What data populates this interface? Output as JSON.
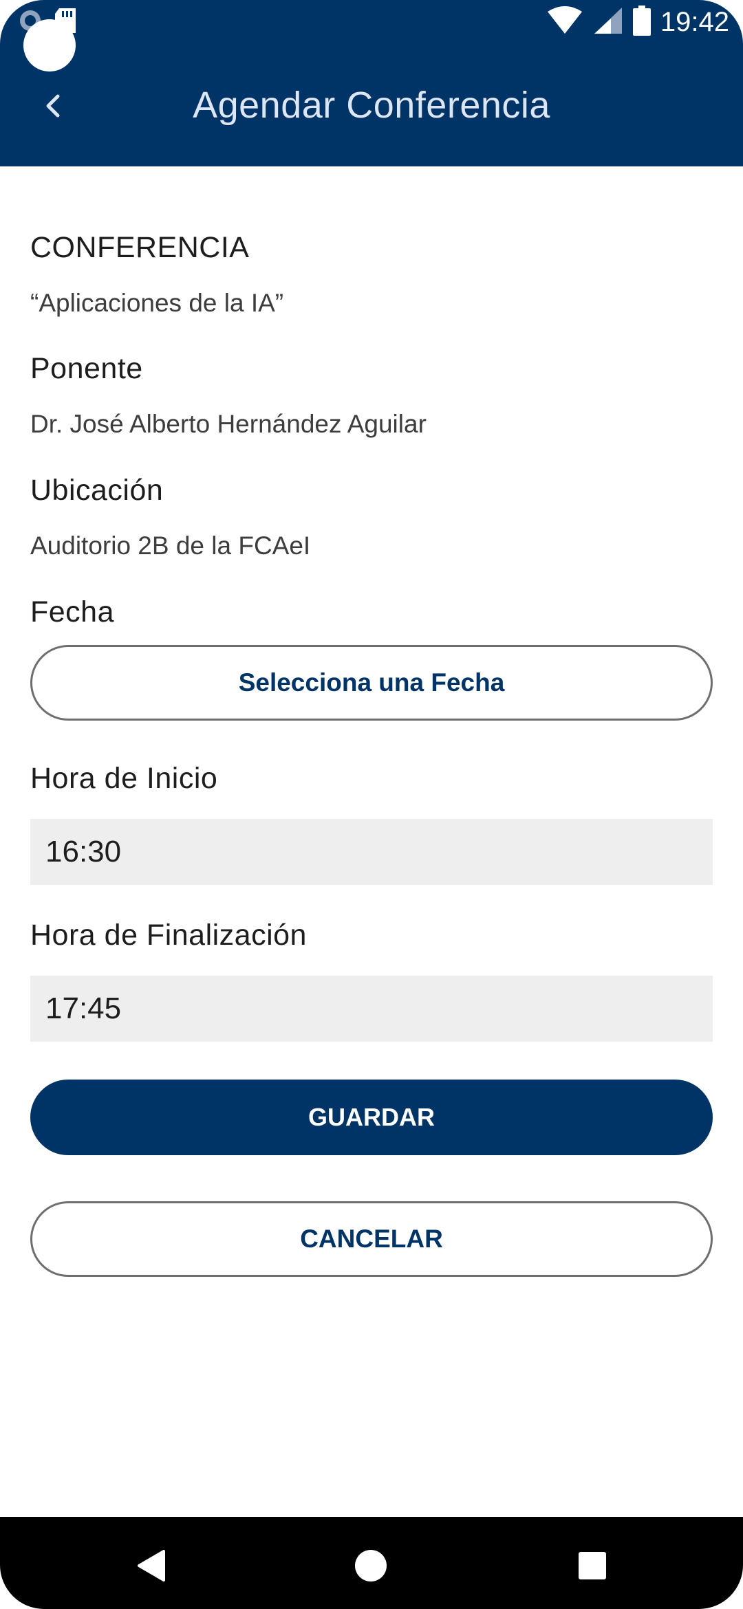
{
  "status_bar": {
    "time": "19:42",
    "icons": [
      "camera-icon",
      "sd-card-icon",
      "wifi-icon",
      "signal-icon",
      "battery-icon"
    ]
  },
  "appbar": {
    "title": "Agendar Conferencia",
    "back_icon": "chevron-left-icon",
    "color": "#003366"
  },
  "conference": {
    "section_label": "CONFERENCIA",
    "name": "“Aplicaciones de la IA”",
    "speaker_label": "Ponente",
    "speaker": "Dr. José Alberto Hernández Aguilar",
    "location_label": "Ubicación",
    "location": "Auditorio 2B de la FCAeI"
  },
  "form": {
    "date_label": "Fecha",
    "date_button": "Selecciona una Fecha",
    "start_label": "Hora de Inicio",
    "start_value": "16:30",
    "end_label": "Hora de Finalización",
    "end_value": "17:45"
  },
  "actions": {
    "save": "GUARDAR",
    "cancel": "CANCELAR"
  },
  "navbar": {
    "icons": [
      "back-triangle-icon",
      "home-circle-icon",
      "recents-square-icon"
    ]
  }
}
